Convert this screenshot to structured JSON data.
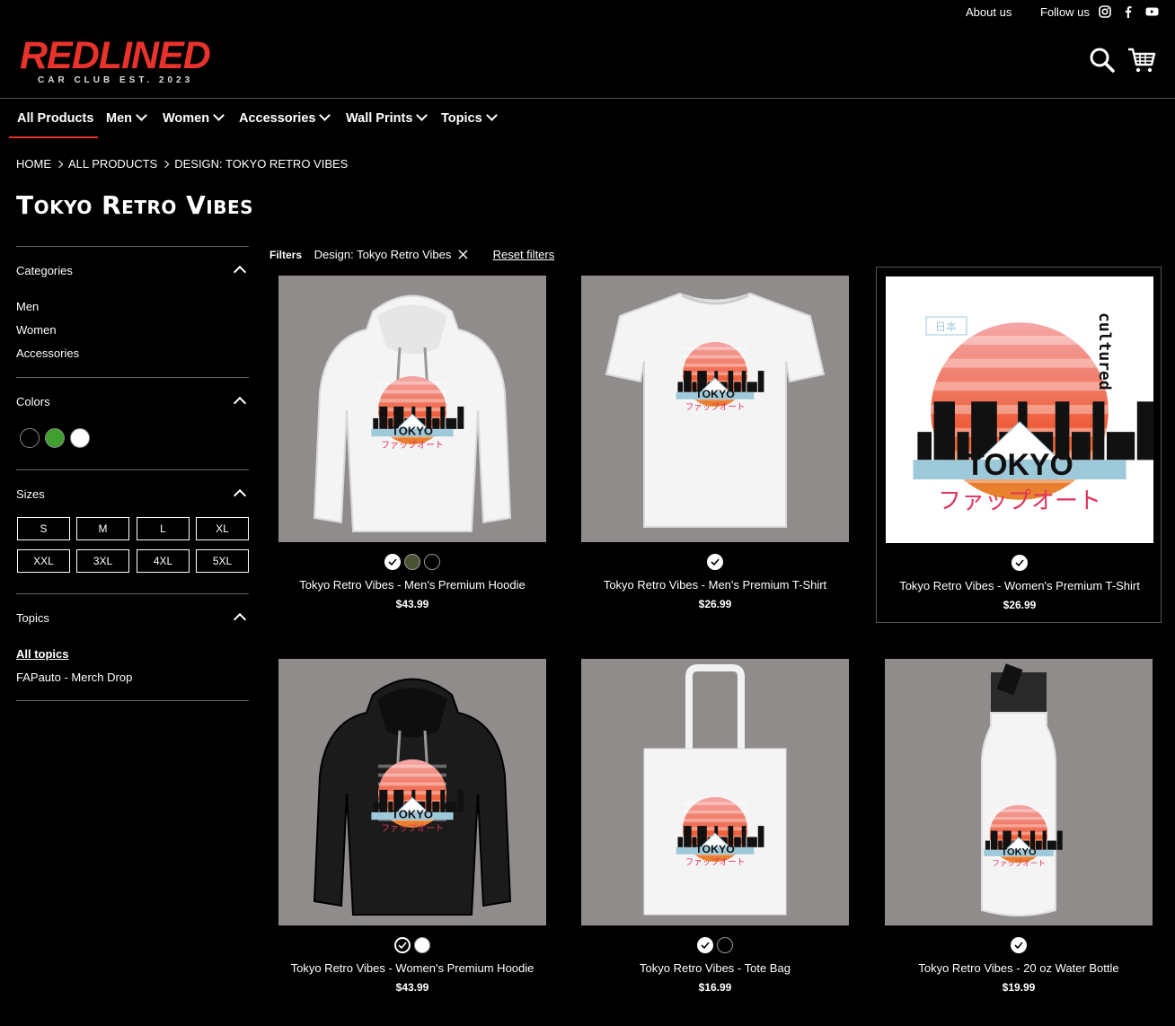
{
  "topbar": {
    "about": "About us",
    "follow": "Follow us"
  },
  "logo": {
    "word_a": "RED",
    "word_b": "LINED",
    "sub": "CAR CLUB EST. 2023"
  },
  "nav": {
    "all_products": "All Products",
    "men": "Men",
    "women": "Women",
    "accessories": "Accessories",
    "wall_prints": "Wall Prints",
    "topics": "Topics"
  },
  "breadcrumb": [
    "HOME",
    "ALL PRODUCTS",
    "DESIGN: TOKYO RETRO VIBES"
  ],
  "page_title": "Tokyo Retro Vibes",
  "sidebar": {
    "categories": {
      "heading": "Categories",
      "items": [
        "Men",
        "Women",
        "Accessories"
      ]
    },
    "colors": {
      "heading": "Colors",
      "swatches": [
        "#000000",
        "#3f9f2f",
        "#ffffff"
      ]
    },
    "sizes": {
      "heading": "Sizes",
      "items": [
        "S",
        "M",
        "L",
        "XL",
        "XXL",
        "3XL",
        "4XL",
        "5XL"
      ]
    },
    "topics": {
      "heading": "Topics",
      "items": [
        "All topics",
        "FAPauto - Merch Drop"
      ]
    }
  },
  "filters": {
    "label": "Filters",
    "active": "Design: Tokyo Retro Vibes",
    "reset": "Reset filters"
  },
  "products": [
    {
      "name": "Tokyo Retro Vibes - Men's Premium Hoodie",
      "price": "$43.99",
      "colors": [
        "#ffffff",
        "#4b5233",
        "#000000"
      ],
      "kind": "hoodie-white"
    },
    {
      "name": "Tokyo Retro Vibes - Men's Premium T-Shirt",
      "price": "$26.99",
      "colors": [
        "#ffffff"
      ],
      "kind": "tshirt"
    },
    {
      "name": "Tokyo Retro Vibes - Women's Premium T-Shirt",
      "price": "$26.99",
      "colors": [
        "#ffffff"
      ],
      "kind": "print"
    },
    {
      "name": "Tokyo Retro Vibes - Women's Premium Hoodie",
      "price": "$43.99",
      "colors": [
        "#000000",
        "#ffffff"
      ],
      "kind": "hoodie-black"
    },
    {
      "name": "Tokyo Retro Vibes - Tote Bag",
      "price": "$16.99",
      "colors": [
        "#ffffff",
        "#000000"
      ],
      "kind": "tote"
    },
    {
      "name": "Tokyo Retro Vibes - 20 oz Water Bottle",
      "price": "$19.99",
      "colors": [
        "#ffffff"
      ],
      "kind": "bottle"
    }
  ],
  "design_text": {
    "tokyo": "TOKYO",
    "jp": "ファップオート",
    "cultured": "cultured",
    "kanji": "日本"
  },
  "colors": {
    "accent": "#e8322b",
    "background": "#000000",
    "product_bg": "#8f8c8b"
  }
}
